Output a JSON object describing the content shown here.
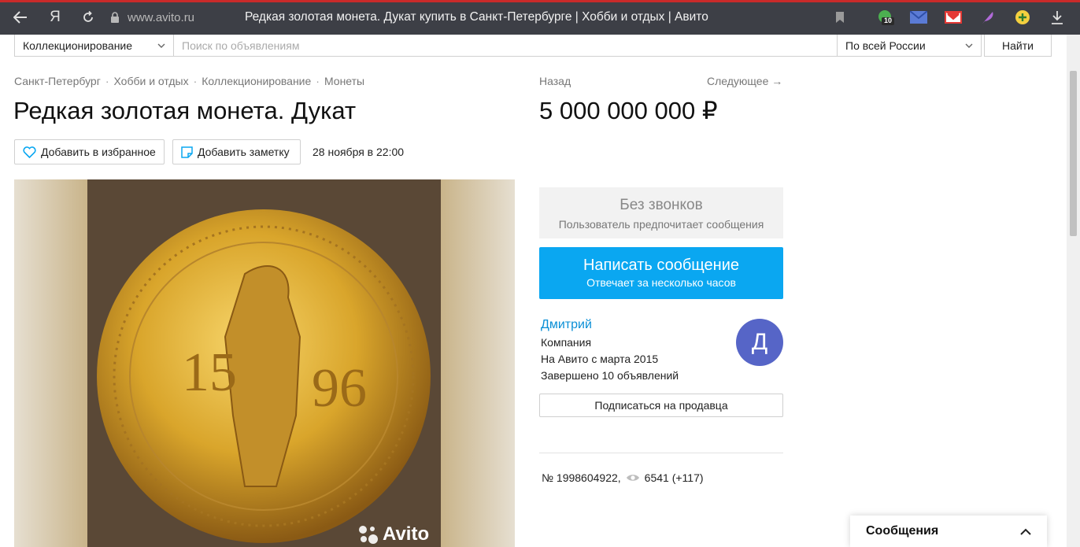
{
  "browser": {
    "url_host": "www.avito.ru",
    "tab_title": "Редкая золотая монета. Дукат купить в Санкт-Петербурге | Хобби и отдых | Авито",
    "extension_badge": "10"
  },
  "search": {
    "category": "Коллекционирование",
    "placeholder": "Поиск по объявлениям",
    "region": "По всей России",
    "find_label": "Найти"
  },
  "breadcrumb": [
    "Санкт-Петербург",
    "Хобби и отдых",
    "Коллекционирование",
    "Монеты"
  ],
  "nav": {
    "back": "Назад",
    "next": "Следующее →"
  },
  "listing": {
    "title": "Редкая золотая монета. Дукат",
    "price": "5 000 000 000 ₽",
    "favorite_label": "Добавить в избранное",
    "note_label": "Добавить заметку",
    "date": "28 ноября в 22:00",
    "watermark": "Avito",
    "number": "№ 1998604922,",
    "views": "6541 (+117)"
  },
  "contact": {
    "no_calls_title": "Без звонков",
    "no_calls_subtitle": "Пользователь предпочитает сообщения",
    "message_title": "Написать сообщение",
    "message_subtitle": "Отвечает за несколько часов"
  },
  "seller": {
    "name": "Дмитрий",
    "type": "Компания",
    "since": "На Авито с марта 2015",
    "completed": "Завершено 10 объявлений",
    "avatar_letter": "Д",
    "subscribe_label": "Подписаться на продавца"
  },
  "messages_panel": {
    "label": "Сообщения"
  },
  "colors": {
    "accent": "#0aa7f1",
    "avatar": "#5665c7",
    "link": "#0a8fd6"
  }
}
